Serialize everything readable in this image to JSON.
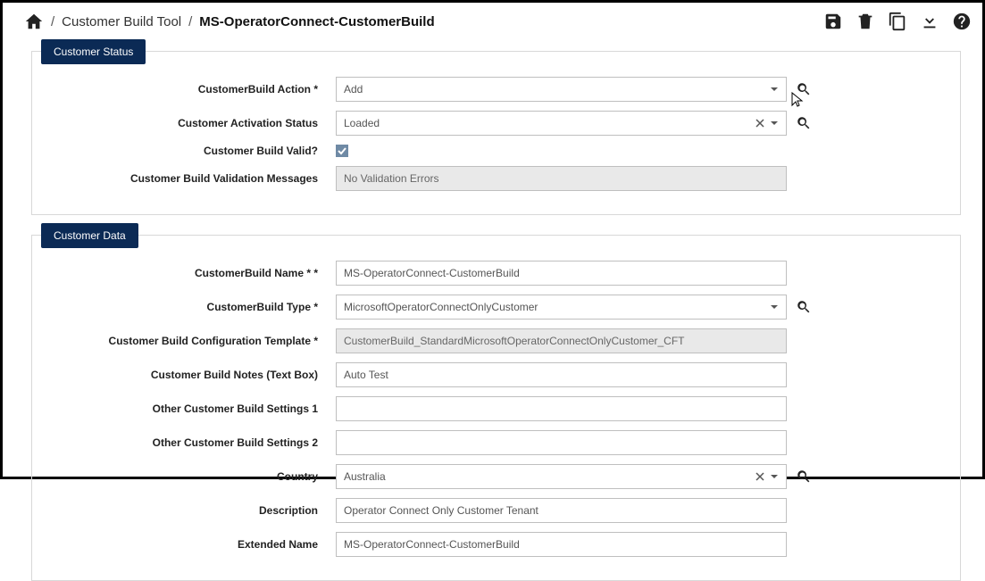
{
  "breadcrumb": {
    "tool": "Customer Build Tool",
    "current": "MS-OperatorConnect-CustomerBuild"
  },
  "panels": {
    "status": {
      "title": "Customer Status",
      "fields": {
        "action_label": "CustomerBuild Action *",
        "action_value": "Add",
        "activation_label": "Customer Activation Status",
        "activation_value": "Loaded",
        "valid_label": "Customer Build Valid?",
        "valid_checked": true,
        "validation_msg_label": "Customer Build Validation Messages",
        "validation_msg_value": "No Validation Errors"
      }
    },
    "data": {
      "title": "Customer Data",
      "fields": {
        "name_label": "CustomerBuild Name * *",
        "name_value": "MS-OperatorConnect-CustomerBuild",
        "type_label": "CustomerBuild Type *",
        "type_value": "MicrosoftOperatorConnectOnlyCustomer",
        "template_label": "Customer Build Configuration Template *",
        "template_value": "CustomerBuild_StandardMicrosoftOperatorConnectOnlyCustomer_CFT",
        "notes_label": "Customer Build Notes (Text Box)",
        "notes_value": "Auto Test",
        "other1_label": "Other Customer Build Settings 1",
        "other1_value": "",
        "other2_label": "Other Customer Build Settings 2",
        "other2_value": "",
        "country_label": "Country",
        "country_value": "Australia",
        "description_label": "Description",
        "description_value": "Operator Connect Only Customer Tenant",
        "extname_label": "Extended Name",
        "extname_value": "MS-OperatorConnect-CustomerBuild"
      }
    }
  }
}
